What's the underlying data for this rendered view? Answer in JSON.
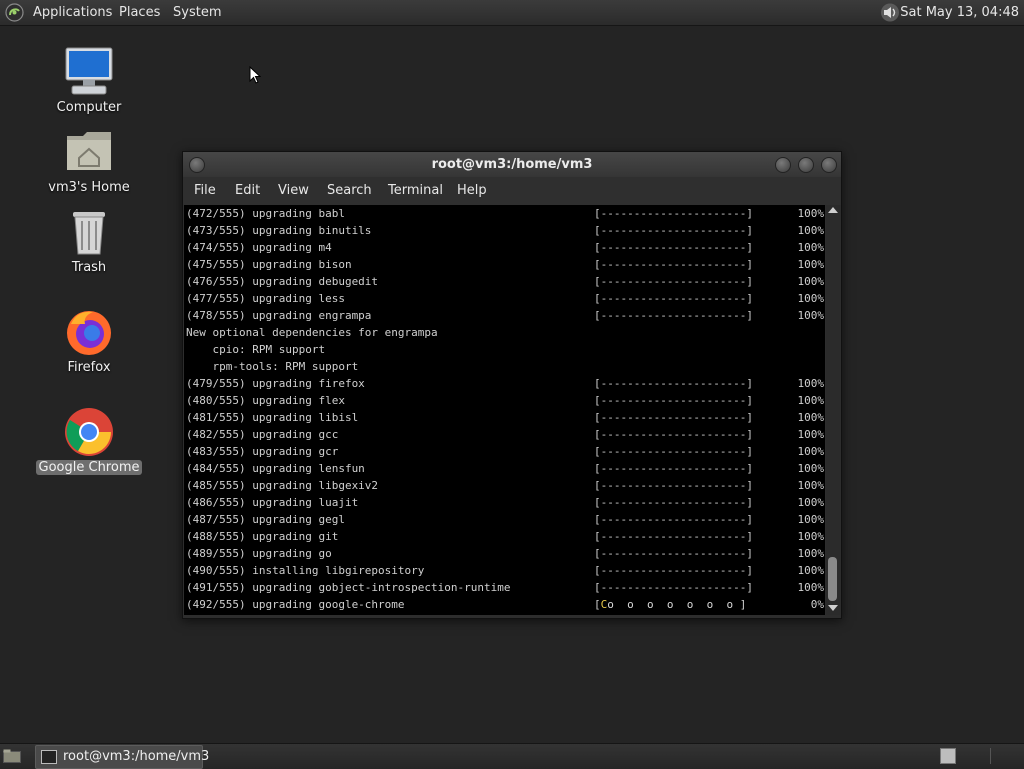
{
  "top_panel": {
    "menus": [
      "Applications",
      "Places",
      "System"
    ],
    "clock": "Sat May 13, 04:48",
    "icons": {
      "app_menu": "mate-logo-icon",
      "volume": "speaker-icon"
    }
  },
  "desktop": {
    "icons": [
      {
        "label": "Computer",
        "icon": "computer-icon"
      },
      {
        "label": "vm3's Home",
        "icon": "home-folder-icon"
      },
      {
        "label": "Trash",
        "icon": "trash-icon"
      },
      {
        "label": "Firefox",
        "icon": "firefox-icon"
      },
      {
        "label": "Google Chrome",
        "icon": "chrome-icon",
        "selected": true
      }
    ]
  },
  "terminal": {
    "title": "root@vm3:/home/vm3",
    "menu": [
      "File",
      "Edit",
      "View",
      "Search",
      "Terminal",
      "Help"
    ],
    "lines": [
      {
        "text": "(472/555) upgrading babl",
        "bar": "[----------------------]",
        "pct": "100%"
      },
      {
        "text": "(473/555) upgrading binutils",
        "bar": "[----------------------]",
        "pct": "100%"
      },
      {
        "text": "(474/555) upgrading m4",
        "bar": "[----------------------]",
        "pct": "100%"
      },
      {
        "text": "(475/555) upgrading bison",
        "bar": "[----------------------]",
        "pct": "100%"
      },
      {
        "text": "(476/555) upgrading debugedit",
        "bar": "[----------------------]",
        "pct": "100%"
      },
      {
        "text": "(477/555) upgrading less",
        "bar": "[----------------------]",
        "pct": "100%"
      },
      {
        "text": "(478/555) upgrading engrampa",
        "bar": "[----------------------]",
        "pct": "100%"
      },
      {
        "text": "New optional dependencies for engrampa"
      },
      {
        "text": "    cpio: RPM support"
      },
      {
        "text": "    rpm-tools: RPM support"
      },
      {
        "text": "(479/555) upgrading firefox",
        "bar": "[----------------------]",
        "pct": "100%"
      },
      {
        "text": "(480/555) upgrading flex",
        "bar": "[----------------------]",
        "pct": "100%"
      },
      {
        "text": "(481/555) upgrading libisl",
        "bar": "[----------------------]",
        "pct": "100%"
      },
      {
        "text": "(482/555) upgrading gcc",
        "bar": "[----------------------]",
        "pct": "100%"
      },
      {
        "text": "(483/555) upgrading gcr",
        "bar": "[----------------------]",
        "pct": "100%"
      },
      {
        "text": "(484/555) upgrading lensfun",
        "bar": "[----------------------]",
        "pct": "100%"
      },
      {
        "text": "(485/555) upgrading libgexiv2",
        "bar": "[----------------------]",
        "pct": "100%"
      },
      {
        "text": "(486/555) upgrading luajit",
        "bar": "[----------------------]",
        "pct": "100%"
      },
      {
        "text": "(487/555) upgrading gegl",
        "bar": "[----------------------]",
        "pct": "100%"
      },
      {
        "text": "(488/555) upgrading git",
        "bar": "[----------------------]",
        "pct": "100%"
      },
      {
        "text": "(489/555) upgrading go",
        "bar": "[----------------------]",
        "pct": "100%"
      },
      {
        "text": "(490/555) installing libgirepository",
        "bar": "[----------------------]",
        "pct": "100%"
      },
      {
        "text": "(491/555) upgrading gobject-introspection-runtime",
        "bar": "[----------------------]",
        "pct": "100%"
      },
      {
        "text": "(492/555) upgrading google-chrome",
        "bar_active": {
          "open": "[",
          "cursor": "C",
          "dots": "o  o  o  o  o  o  o",
          "close": " ]"
        },
        "pct": "0%"
      }
    ]
  },
  "taskbar": {
    "task_label": "root@vm3:/home/vm3",
    "icons": {
      "show_desktop": "show-desktop-icon",
      "task": "terminal-icon",
      "workspace": "workspace-switcher-icon"
    }
  }
}
